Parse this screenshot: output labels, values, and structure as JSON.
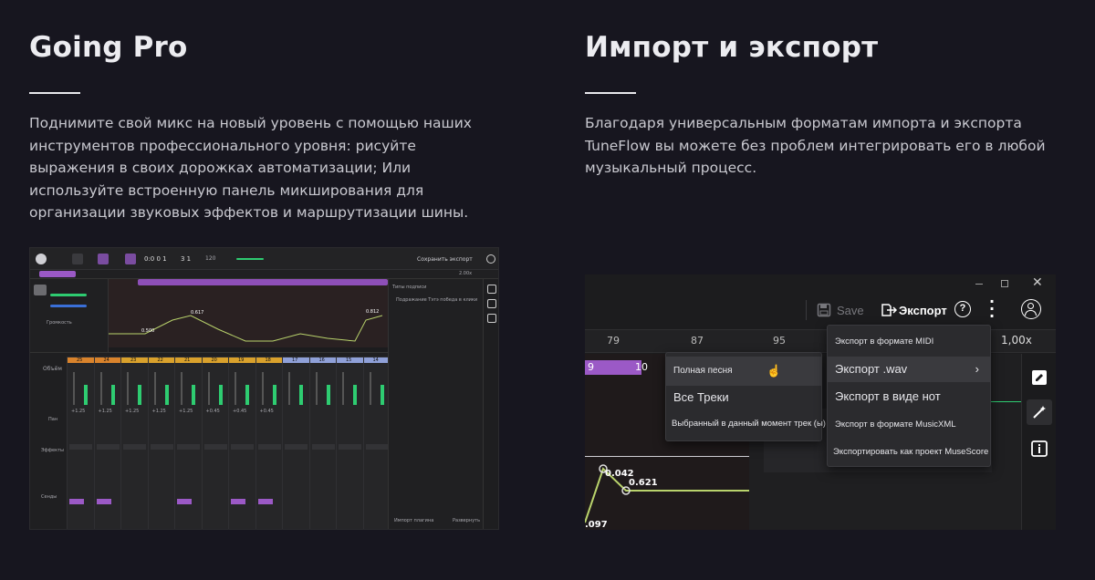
{
  "left": {
    "title": "Going Pro",
    "description": "Поднимите свой микс на новый уровень с помощью наших инструментов профессионального уровня: рисуйте выражения в своих дорожках автоматизации; Или используйте встроенную панель микширования для организации звуковых эффектов и маршрутизации шины."
  },
  "right": {
    "title": "Импорт и экспорт",
    "description": "Благодаря универсальным форматам импорта и экспорта TuneFlow вы можете без проблем интегрировать его в любой музыкальный процесс."
  },
  "shot1": {
    "time": "0:0 0 1",
    "bar": "3 1",
    "tempo": "120",
    "save_export": "Сохранить экспорт",
    "ruler_marks": [
      "1",
      "5",
      "9",
      "13",
      "17",
      "21",
      "25",
      "29",
      "33",
      "37",
      "41",
      "45",
      "49",
      "53"
    ],
    "zoom": "2.00x",
    "volume_label": "Громкость",
    "auto_values": [
      "0.617",
      "0.500",
      "0.812"
    ],
    "mixer_label": "Объём",
    "channel_numbers": [
      "25",
      "24",
      "23",
      "22",
      "21",
      "20",
      "19",
      "18",
      "17",
      "16",
      "15",
      "14"
    ],
    "pan_label": "Пан",
    "effects_label": "Эффекты",
    "sends_label": "Сенды",
    "side_title": "Типы подписи",
    "side_item": "Подражание Тэтэ победа в клики",
    "side_footer_left": "Импорт плагина",
    "side_footer_right": "Развернуть",
    "db_values": [
      "+1.25",
      "+1.25",
      "+1.25",
      "+1.25",
      "+1.25",
      "+0.45",
      "+0.45",
      "+0.45"
    ]
  },
  "shot2": {
    "save_label": "Save",
    "export_label": "Экспорт",
    "ruler_marks": [
      "79",
      "87",
      "95"
    ],
    "zoom": "1,00x",
    "clip_numbers": [
      "9",
      "10"
    ],
    "values": [
      "0.042",
      "0.621",
      ".097"
    ],
    "submenu": {
      "items": [
        "Полная песня",
        "Все Треки",
        "Выбранный в данный момент трек (ы)"
      ]
    },
    "export_menu": {
      "items": [
        "Экспорт в формате MIDI",
        "Экспорт .wav",
        "Экспорт в виде нот",
        "Экспорт в формате MusicXML",
        "Экспортировать как проект MuseScore"
      ]
    }
  },
  "colors": {
    "background": "#17161f",
    "accent_purple": "#9b59c6",
    "meter_green": "#2ecc71",
    "automation_green": "#b9d36c"
  },
  "icons": [
    "save-icon",
    "export-icon",
    "help-icon",
    "more-icon",
    "account-icon",
    "minimize-icon",
    "maximize-icon",
    "close-icon",
    "edit-icon",
    "magic-icon",
    "info-icon",
    "chevron-right-icon",
    "cursor-icon"
  ]
}
